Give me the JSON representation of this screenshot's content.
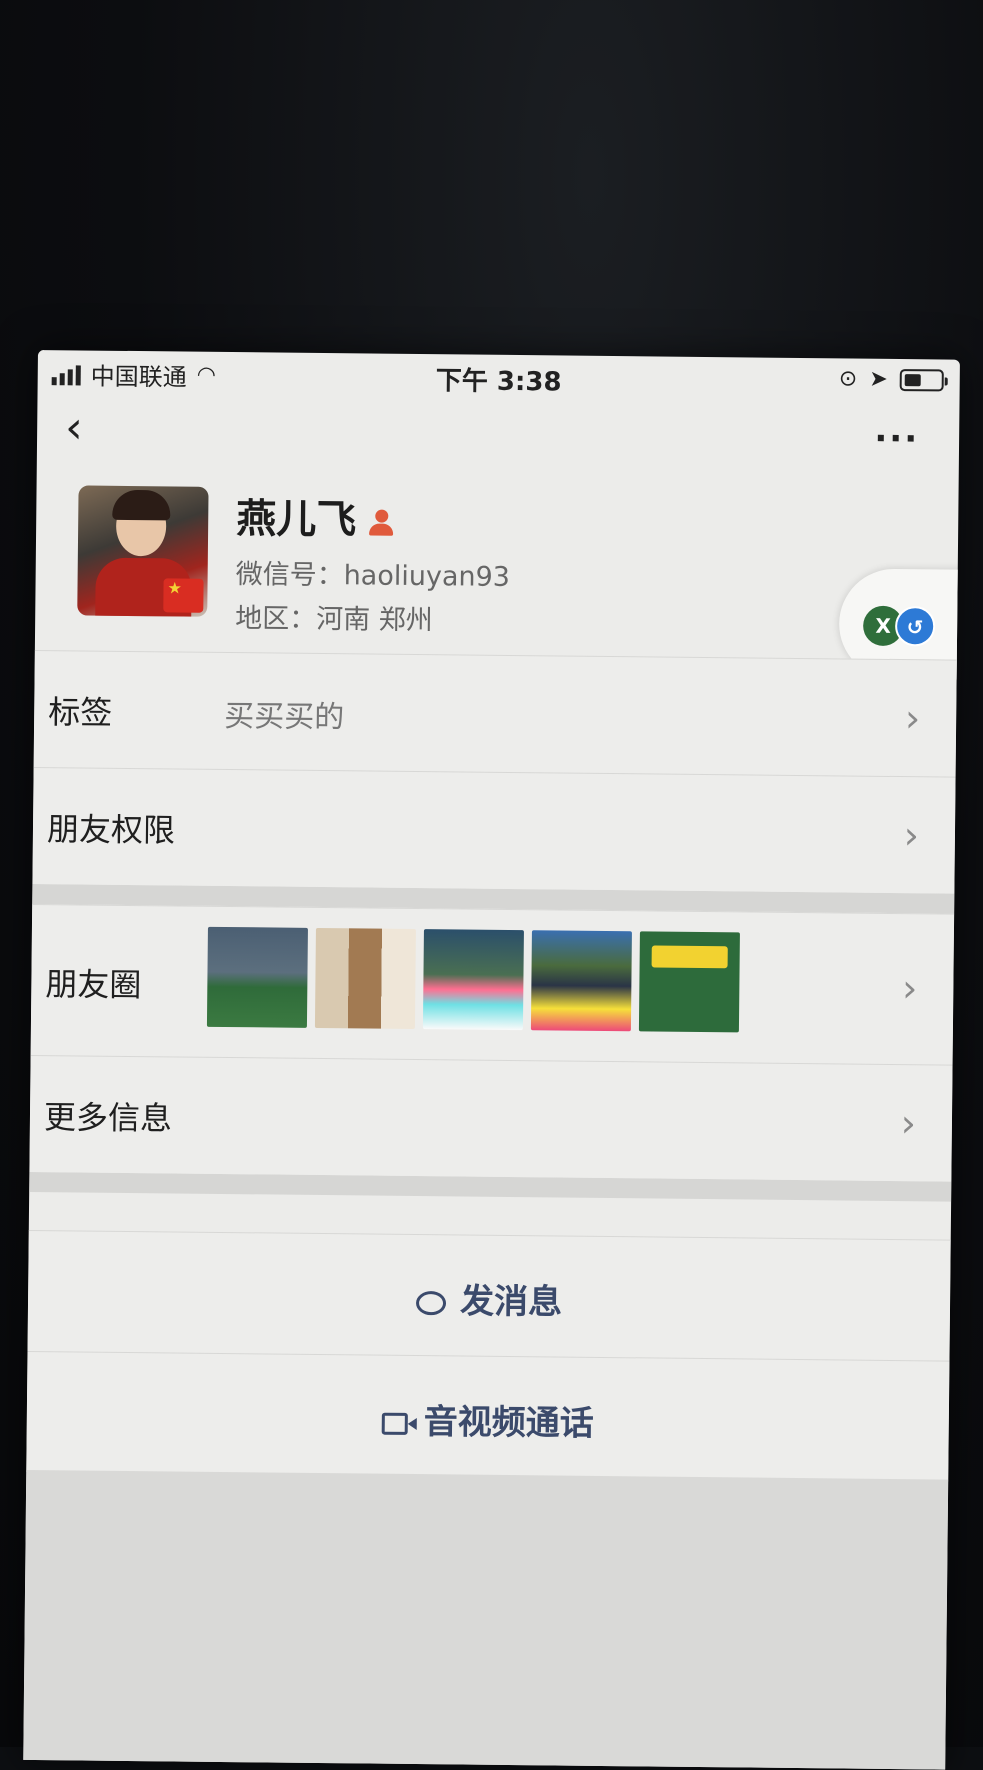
{
  "status_bar": {
    "carrier": "中国联通",
    "time": "下午 3:38"
  },
  "nav": {
    "back_icon": "back-chevron-icon",
    "more_label": "···"
  },
  "profile": {
    "name": "燕儿飞",
    "wechat_id": "微信号：haoliuyan93",
    "region": "地区：河南 郑州"
  },
  "side_badges": {
    "first": "X",
    "second": "↺"
  },
  "rows": [
    {
      "label": "标签",
      "value": "买买买的"
    },
    {
      "label": "朋友权限",
      "value": ""
    }
  ],
  "moments": {
    "label": "朋友圈",
    "thumbnail_count": 5
  },
  "more_info": {
    "label": "更多信息"
  },
  "actions": {
    "send_message": "发消息",
    "video_call": "音视频通话"
  },
  "colors": {
    "accent": "#3b4a6b",
    "background": "#ededeb"
  }
}
